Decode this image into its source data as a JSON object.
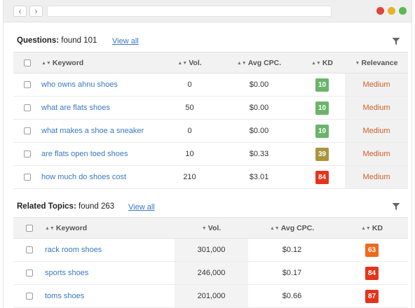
{
  "browser": {
    "back_icon": "chevron-left-icon",
    "forward_icon": "chevron-right-icon",
    "back_glyph": "‹",
    "forward_glyph": "›",
    "dots": [
      "#e0443e",
      "#e9b02c",
      "#5cb84f"
    ]
  },
  "questions": {
    "title": "Questions:",
    "found": "found 101",
    "view_all": "View all",
    "filter_icon": "filter-icon",
    "columns": {
      "keyword": "Keyword",
      "vol": "Vol.",
      "cpc": "Avg CPC.",
      "kd": "KD",
      "relevance": "Relevance"
    },
    "rows": [
      {
        "keyword": "who owns ahnu shoes",
        "vol": "0",
        "cpc": "$0.00",
        "kd": "10",
        "kd_color": "#6bb46a",
        "relevance": "Medium"
      },
      {
        "keyword": "what are flats shoes",
        "vol": "50",
        "cpc": "$0.00",
        "kd": "10",
        "kd_color": "#6bb46a",
        "relevance": "Medium"
      },
      {
        "keyword": "what makes a shoe a sneaker",
        "vol": "0",
        "cpc": "$0.00",
        "kd": "10",
        "kd_color": "#6bb46a",
        "relevance": "Medium"
      },
      {
        "keyword": "are flats open toed shoes",
        "vol": "10",
        "cpc": "$0.33",
        "kd": "39",
        "kd_color": "#a9953e",
        "relevance": "Medium"
      },
      {
        "keyword": "how much do shoes cost",
        "vol": "210",
        "cpc": "$3.01",
        "kd": "84",
        "kd_color": "#e5341c",
        "relevance": "Medium"
      }
    ]
  },
  "related": {
    "title": "Related Topics:",
    "found": "found 263",
    "view_all": "View all",
    "filter_icon": "filter-icon",
    "columns": {
      "keyword": "Keyword",
      "vol": "Vol.",
      "cpc": "Avg CPC.",
      "kd": "KD"
    },
    "rows": [
      {
        "keyword": "rack room shoes",
        "vol": "301,000",
        "cpc": "$0.12",
        "kd": "63",
        "kd_color": "#ee6a1c"
      },
      {
        "keyword": "sports shoes",
        "vol": "246,000",
        "cpc": "$0.17",
        "kd": "84",
        "kd_color": "#e5341c"
      },
      {
        "keyword": "toms shoes",
        "vol": "201,000",
        "cpc": "$0.66",
        "kd": "87",
        "kd_color": "#e5341c"
      }
    ]
  }
}
